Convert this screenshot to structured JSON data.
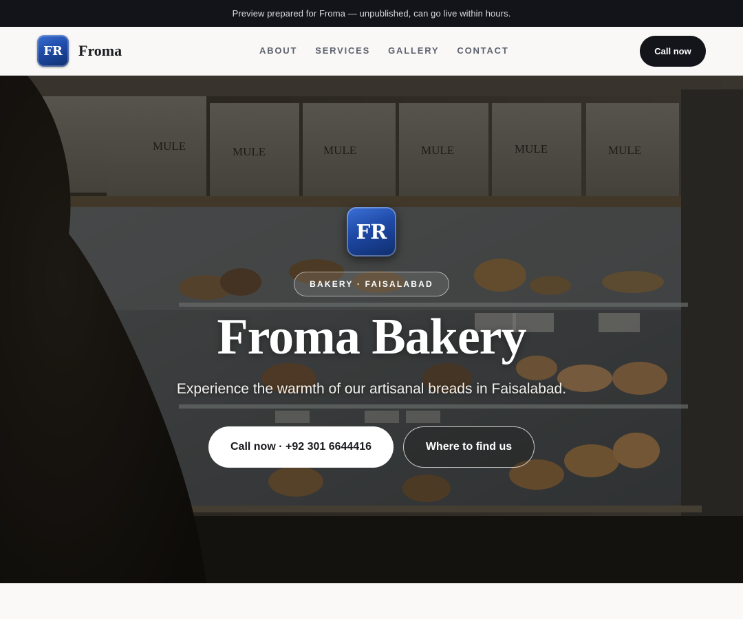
{
  "banner": {
    "text": "Preview prepared for Froma — unpublished, can go live within hours."
  },
  "header": {
    "logo_initials": "FR",
    "brand_name": "Froma",
    "nav": [
      {
        "label": "ABOUT"
      },
      {
        "label": "SERVICES"
      },
      {
        "label": "GALLERY"
      },
      {
        "label": "CONTACT"
      }
    ],
    "call_label": "Call now"
  },
  "hero": {
    "logo_initials": "FR",
    "tag": "BAKERY · FAISALABAD",
    "title": "Froma Bakery",
    "subtitle": "Experience the warmth of our artisanal breads in Faisalabad.",
    "primary_button": "Call now · +92 301 6644416",
    "secondary_button": "Where to find us",
    "box_label": "MULE"
  },
  "colors": {
    "banner_bg": "#12141a",
    "header_bg": "#f9f8f6",
    "accent_blue": "#1f4ba8",
    "dark_button": "#14151b"
  }
}
